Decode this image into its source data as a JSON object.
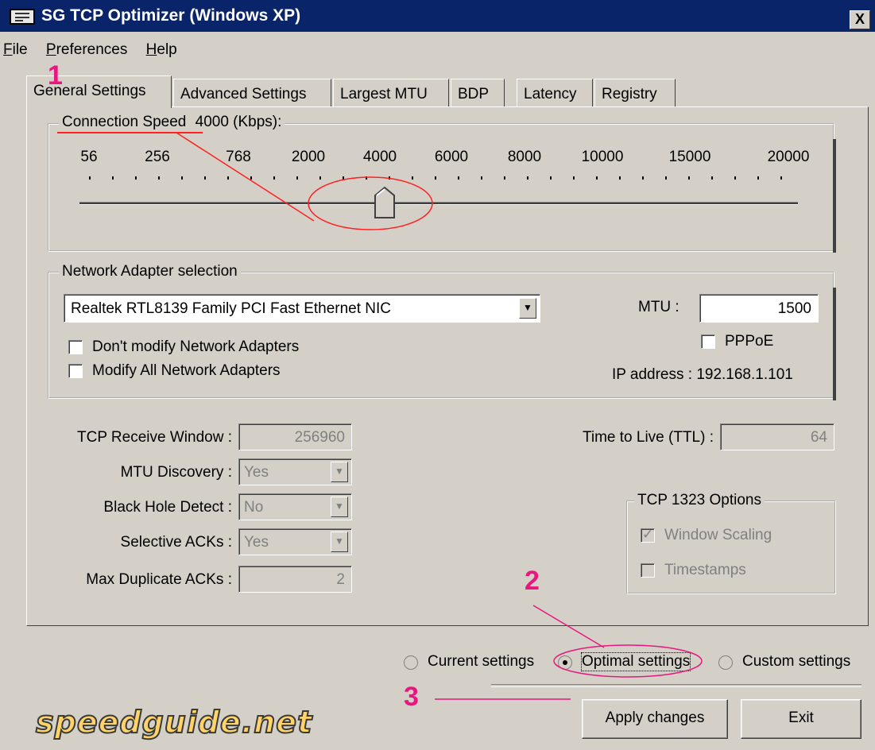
{
  "window": {
    "title": "SG TCP Optimizer (Windows XP)",
    "close_label": "X"
  },
  "menu": {
    "items": [
      "File",
      "Preferences",
      "Help"
    ]
  },
  "tabs": [
    "General Settings",
    "Advanced Settings",
    "Largest MTU",
    "BDP",
    "Latency",
    "Registry"
  ],
  "connection": {
    "legend": "Connection Speed",
    "value_text": "4000 (Kbps):",
    "scale_labels": [
      "56",
      "256",
      "768",
      "2000",
      "4000",
      "6000",
      "8000",
      "10000",
      "15000",
      "20000"
    ]
  },
  "adapter": {
    "legend": "Network Adapter selection",
    "selected": "Realtek RTL8139 Family PCI Fast Ethernet NIC",
    "mtu_label": "MTU :",
    "mtu_value": "1500",
    "pppoe_label": "PPPoE",
    "dont_modify_label": "Don't modify Network Adapters",
    "modify_all_label": "Modify All Network Adapters",
    "ip_label": "IP address : 192.168.1.101"
  },
  "settings": {
    "rwin_label": "TCP Receive Window :",
    "rwin_value": "256960",
    "mtu_disc_label": "MTU Discovery :",
    "mtu_disc_value": "Yes",
    "blackhole_label": "Black Hole Detect :",
    "blackhole_value": "No",
    "sack_label": "Selective ACKs :",
    "sack_value": "Yes",
    "dupack_label": "Max Duplicate ACKs :",
    "dupack_value": "2",
    "ttl_label": "Time to Live (TTL) :",
    "ttl_value": "64"
  },
  "tcp1323": {
    "legend": "TCP 1323 Options",
    "window_scaling": "Window Scaling",
    "timestamps": "Timestamps"
  },
  "modes": {
    "current": "Current settings",
    "optimal": "Optimal settings",
    "custom": "Custom settings"
  },
  "buttons": {
    "apply": "Apply changes",
    "exit": "Exit"
  },
  "annotations": {
    "one": "1",
    "two": "2",
    "three": "3"
  },
  "logo_text": "speedguide.net",
  "colors": {
    "titlebar": "#0a246a",
    "face": "#d4d0c8",
    "annotation": "#e8177f"
  }
}
